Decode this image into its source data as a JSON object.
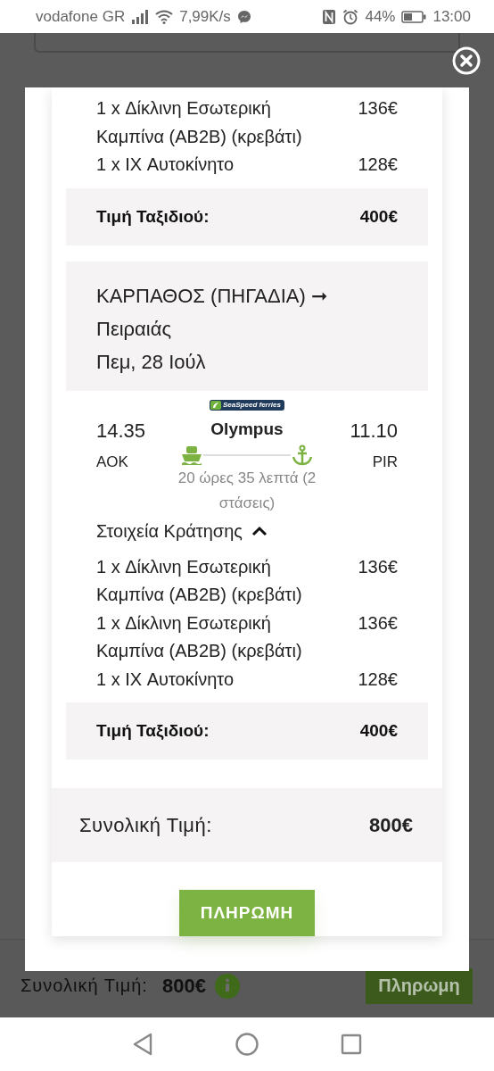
{
  "status_bar": {
    "carrier": "vodafone GR",
    "speed": "7,99K/s",
    "battery": "44%",
    "time": "13:00"
  },
  "background": {
    "total_label": "Συνολική Τιμή:",
    "total": "800€",
    "pay_button": "Πληρωμη"
  },
  "modal": {
    "trips": [
      {
        "items": [
          {
            "name": "1 x Δίκλινη Εσωτερική Καμπίνα (AB2B) (κρεβάτι)",
            "price": "136€"
          },
          {
            "name": "1 x IX Αυτοκίνητο",
            "price": "128€"
          }
        ],
        "total_label": "Τιμή Ταξιδιού:",
        "total": "400€"
      },
      {
        "route": "ΚΑΡΠΑΘΟΣ (ΠΗΓΑΔΙΑ) ➞ Πειραιάς",
        "date": "Πεμ, 28 Ιούλ",
        "operator_logo": "SeaSpeed ferries",
        "departure": {
          "time": "14.35",
          "port": "AOK"
        },
        "vessel": "Olympus",
        "arrival": {
          "time": "11.10",
          "port": "PIR"
        },
        "duration": "20 ώρες 35 λεπτά (2 στάσεις)",
        "details_label": "Στοιχεία Κράτησης",
        "details_expanded": true,
        "items": [
          {
            "name": "1 x Δίκλινη Εσωτερική Καμπίνα (AB2B) (κρεβάτι)",
            "price": "136€"
          },
          {
            "name": "1 x Δίκλινη Εσωτερική Καμπίνα (AB2B) (κρεβάτι)",
            "price": "136€"
          },
          {
            "name": "1 x IX Αυτοκίνητο",
            "price": "128€"
          }
        ],
        "total_label": "Τιμή Ταξιδιού:",
        "total": "400€"
      }
    ],
    "grand_total_label": "Συνολική Τιμή:",
    "grand_total": "800€",
    "pay_button": "ΠΛΗΡΩΜΗ"
  }
}
